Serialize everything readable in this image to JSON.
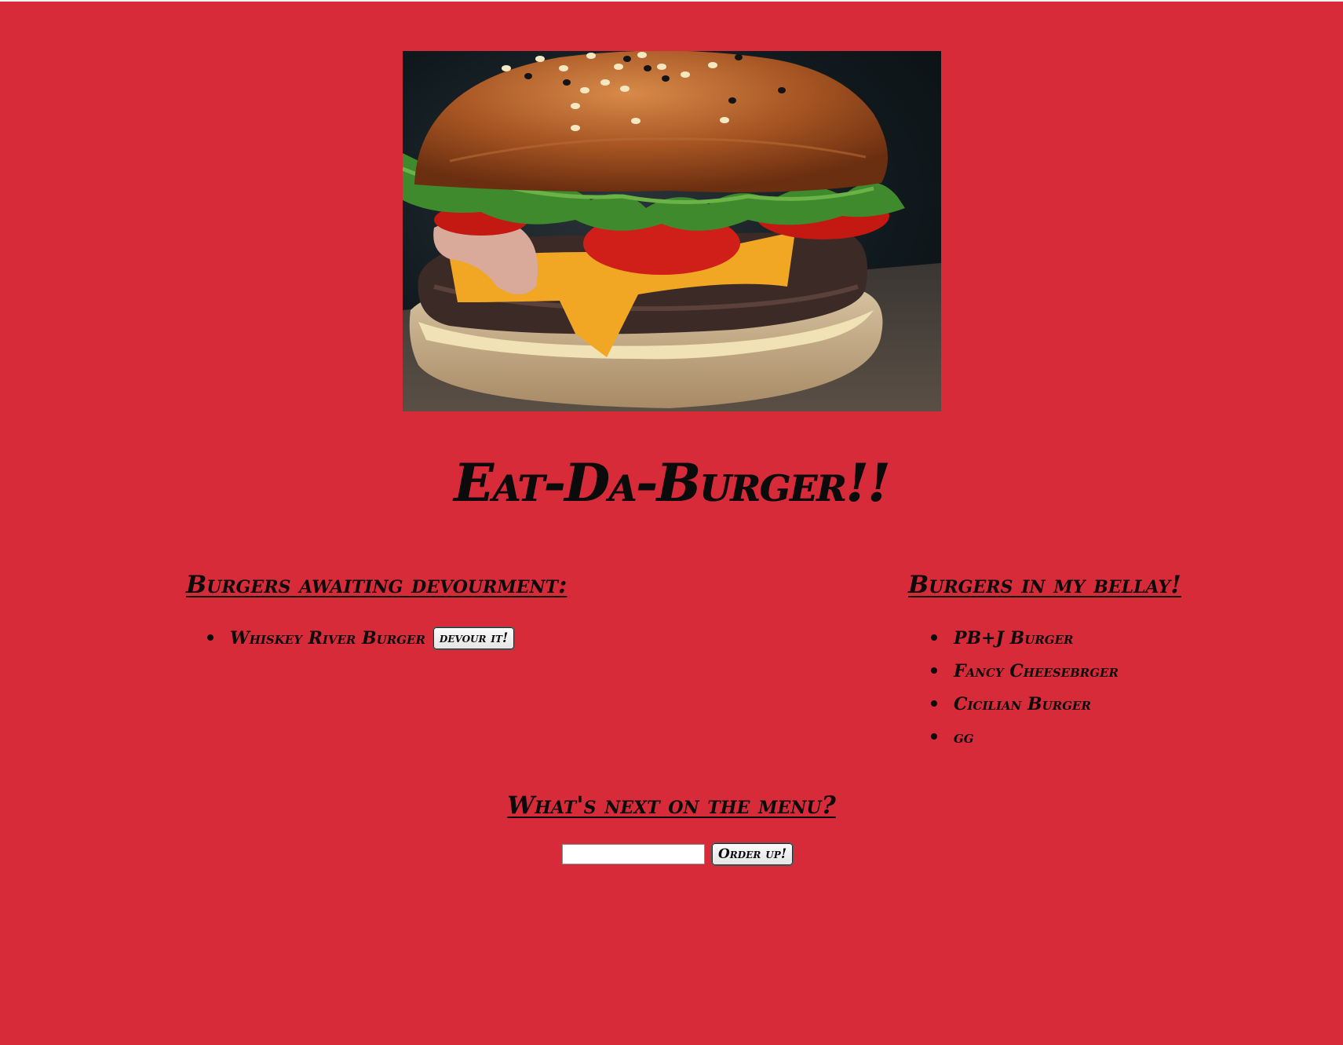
{
  "hero": {
    "image_name": "burger-photo"
  },
  "title": "Eat-Da-Burger!!",
  "awaiting": {
    "heading": "Burgers awaiting devourment:",
    "items": [
      {
        "name": "Whiskey River Burger",
        "button_label": "devour it!"
      }
    ]
  },
  "devoured": {
    "heading": "Burgers in my bellay!",
    "items": [
      {
        "name": "PB+J Burger"
      },
      {
        "name": "Fancy Cheesebrger"
      },
      {
        "name": "Cicilian Burger"
      },
      {
        "name": "gg"
      }
    ]
  },
  "order": {
    "heading": "What's next on the menu?",
    "input_value": "",
    "button_label": "Order up!"
  },
  "colors": {
    "background": "#d82b3a",
    "text": "#0b0b0b"
  }
}
